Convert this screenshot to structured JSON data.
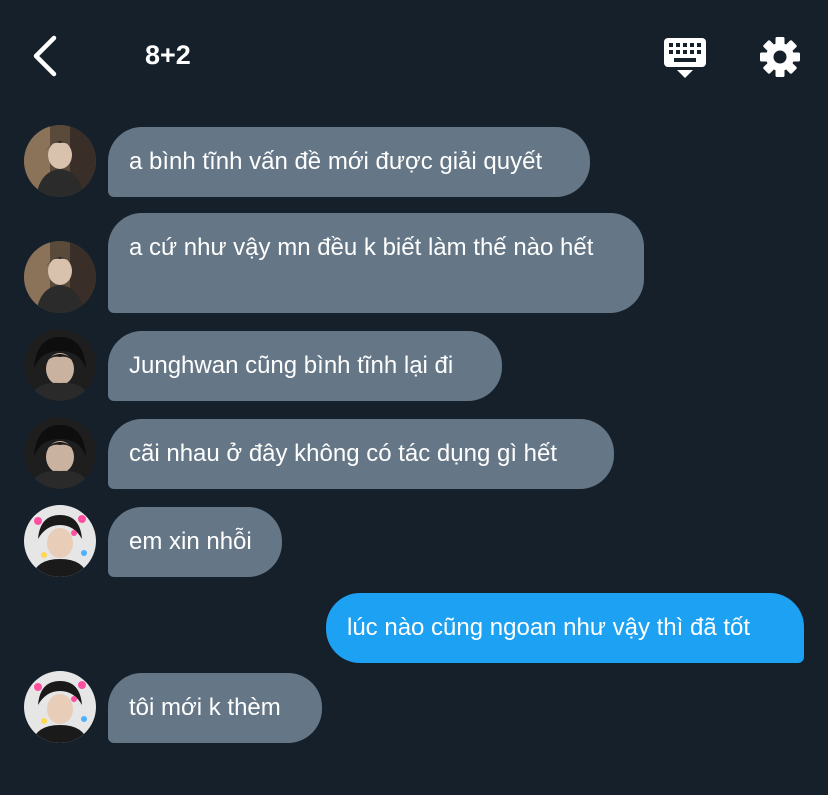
{
  "header": {
    "title": "8+2",
    "back_icon": "chevron-left-icon",
    "keyboard_icon": "keyboard-icon",
    "settings_icon": "gear-icon"
  },
  "colors": {
    "background": "#15202b",
    "incoming_bubble": "#657786",
    "outgoing_bubble": "#1da1f2",
    "text": "#ffffff"
  },
  "messages": [
    {
      "direction": "incoming",
      "sender_avatar": "avatar-1",
      "text": "a bình tĩnh vấn đề mới được giải quyết"
    },
    {
      "direction": "incoming",
      "sender_avatar": "avatar-1",
      "text": "a cứ như vậy mn đều k biết làm thế nào hết"
    },
    {
      "direction": "incoming",
      "sender_avatar": "avatar-2",
      "text": "Junghwan cũng bình tĩnh lại đi"
    },
    {
      "direction": "incoming",
      "sender_avatar": "avatar-2",
      "text": "cãi nhau ở đây không có tác dụng gì hết"
    },
    {
      "direction": "incoming",
      "sender_avatar": "avatar-3",
      "text": "em xin nhỗi"
    },
    {
      "direction": "outgoing",
      "text": "lúc nào cũng ngoan như vậy thì đã tốt"
    },
    {
      "direction": "incoming",
      "sender_avatar": "avatar-3",
      "text": "tôi mới k thèm"
    }
  ]
}
